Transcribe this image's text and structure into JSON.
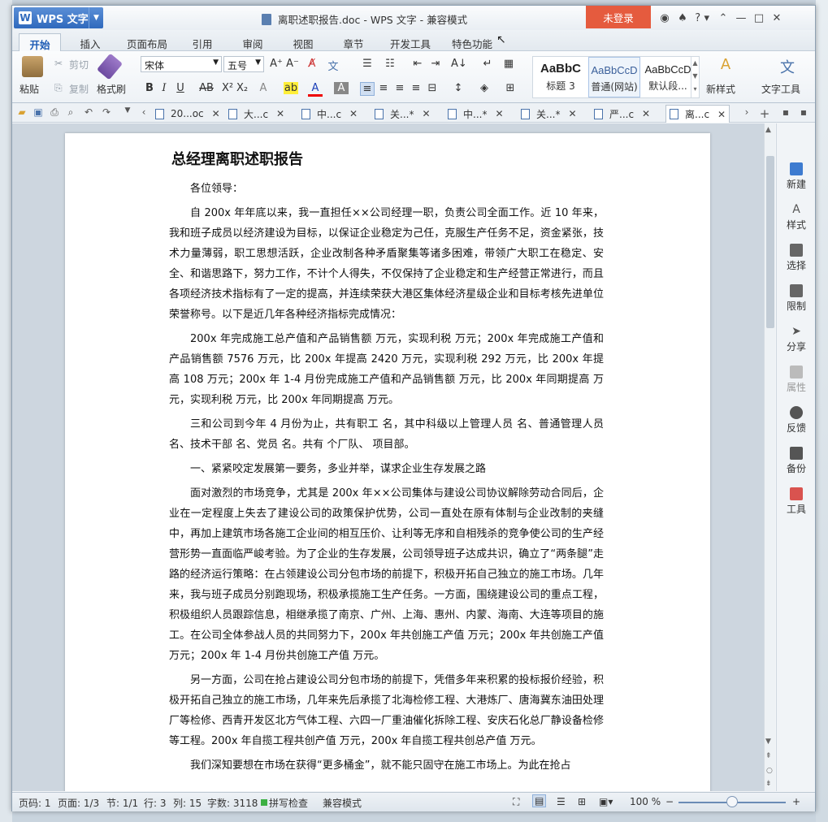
{
  "app": {
    "name": "WPS 文字",
    "window_title": "离职述职报告.doc - WPS 文字 - 兼容模式",
    "login_label": "未登录",
    "help_label": "?"
  },
  "ribbon_tabs": [
    "开始",
    "插入",
    "页面布局",
    "引用",
    "审阅",
    "视图",
    "章节",
    "开发工具",
    "特色功能"
  ],
  "ribbon": {
    "paste": "粘贴",
    "cut": "剪切",
    "copy": "复制",
    "format_painter": "格式刷",
    "font_name": "宋体",
    "font_size": "五号",
    "styles": [
      {
        "preview": "AaBbC",
        "label": "标题 3"
      },
      {
        "preview": "AaBbCcD",
        "label": "普通(网站)"
      },
      {
        "preview": "AaBbCcD",
        "label": "默认段..."
      }
    ],
    "new_style": "新样式",
    "text_tools": "文字工具"
  },
  "doc_tabs": [
    {
      "label": "20...oc",
      "active": false
    },
    {
      "label": "大...c",
      "active": false
    },
    {
      "label": "中...c",
      "active": false
    },
    {
      "label": "关...*",
      "active": false
    },
    {
      "label": "中...*",
      "active": false
    },
    {
      "label": "关...*",
      "active": false
    },
    {
      "label": "严...c",
      "active": false
    },
    {
      "label": "离...c",
      "active": true
    }
  ],
  "document": {
    "title": "总经理离职述职报告",
    "paragraphs": [
      "各位领导：",
      "自 200x 年年底以来，我一直担任××公司经理一职，负责公司全面工作。近 10 年来，我和班子成员以经济建设为目标，以保证企业稳定为己任，克服生产任务不足，资金紧张，技术力量薄弱，职工思想活跃，企业改制各种矛盾聚集等诸多困难，带领广大职工在稳定、安全、和谐思路下，努力工作，不计个人得失，不仅保持了企业稳定和生产经营正常进行，而且各项经济技术指标有了一定的提高，并连续荣获大港区集体经济星级企业和目标考核先进单位荣誉称号。以下是近几年各种经济指标完成情况：",
      "200x 年完成施工总产值和产品销售额  万元，实现利税  万元；200x 年完成施工产值和产品销售额 7576 万元，比 200x 年提高 2420 万元，实现利税 292 万元，比 200x 年提高 108 万元；200x 年 1-4 月份完成施工产值和产品销售额  万元，比 200x 年同期提高  万元，实现利税  万元，比 200x 年同期提高  万元。",
      "三和公司到今年 4 月份为止，共有职工  名，其中科级以上管理人员  名、普通管理人员  名、技术干部  名、党员  名。共有  个厂队、  项目部。",
      "一、紧紧咬定发展第一要务，多业并举，谋求企业生存发展之路",
      "面对激烈的市场竞争，尤其是 200x 年××公司集体与建设公司协议解除劳动合同后，企业在一定程度上失去了建设公司的政策保护优势，公司一直处在原有体制与企业改制的夹缝中，再加上建筑市场各施工企业间的相互压价、让利等无序和自相残杀的竞争使公司的生产经营形势一直面临严峻考验。为了企业的生存发展，公司领导班子达成共识，确立了“两条腿”走路的经济运行策略：在占领建设公司分包市场的前提下，积极开拓自己独立的施工市场。几年来，我与班子成员分别跑现场，积极承揽施工生产任务。一方面，围绕建设公司的重点工程，积极组织人员跟踪信息，相继承揽了南京、广州、上海、惠州、内蒙、海南、大连等项目的施工。在公司全体参战人员的共同努力下，200x 年共创施工产值  万元；200x 年共创施工产值  万元；200x 年 1-4 月份共创施工产值  万元。",
      "另一方面，公司在抢占建设公司分包市场的前提下，凭借多年来积累的投标报价经验，积极开拓自己独立的施工市场，几年来先后承揽了北海检修工程、大港炼厂、唐海冀东油田处理厂等检修、西青开发区北方气体工程、六四一厂重油催化拆除工程、安庆石化总厂静设备检修等工程。200x 年自揽工程共创产值  万元，200x 年自揽工程共创总产值  万元。",
      "我们深知要想在市场在获得“更多桶金”，就不能只固守在施工市场上。为此在抢占"
    ]
  },
  "sidebar": [
    "新建",
    "样式",
    "选择",
    "限制",
    "分享",
    "属性",
    "反馈",
    "备份",
    "工具"
  ],
  "status": {
    "page_code": "页码: 1",
    "pages": "页面: 1/3",
    "section": "节: 1/1",
    "row": "行: 3",
    "col": "列: 15",
    "words": "字数: 3118",
    "spellcheck": "拼写检查",
    "mode": "兼容模式",
    "zoom": "100 %",
    "zoom_level": 0.5
  },
  "colors": {
    "accent": "#2f69bd",
    "login_bg": "#e55b3e"
  }
}
